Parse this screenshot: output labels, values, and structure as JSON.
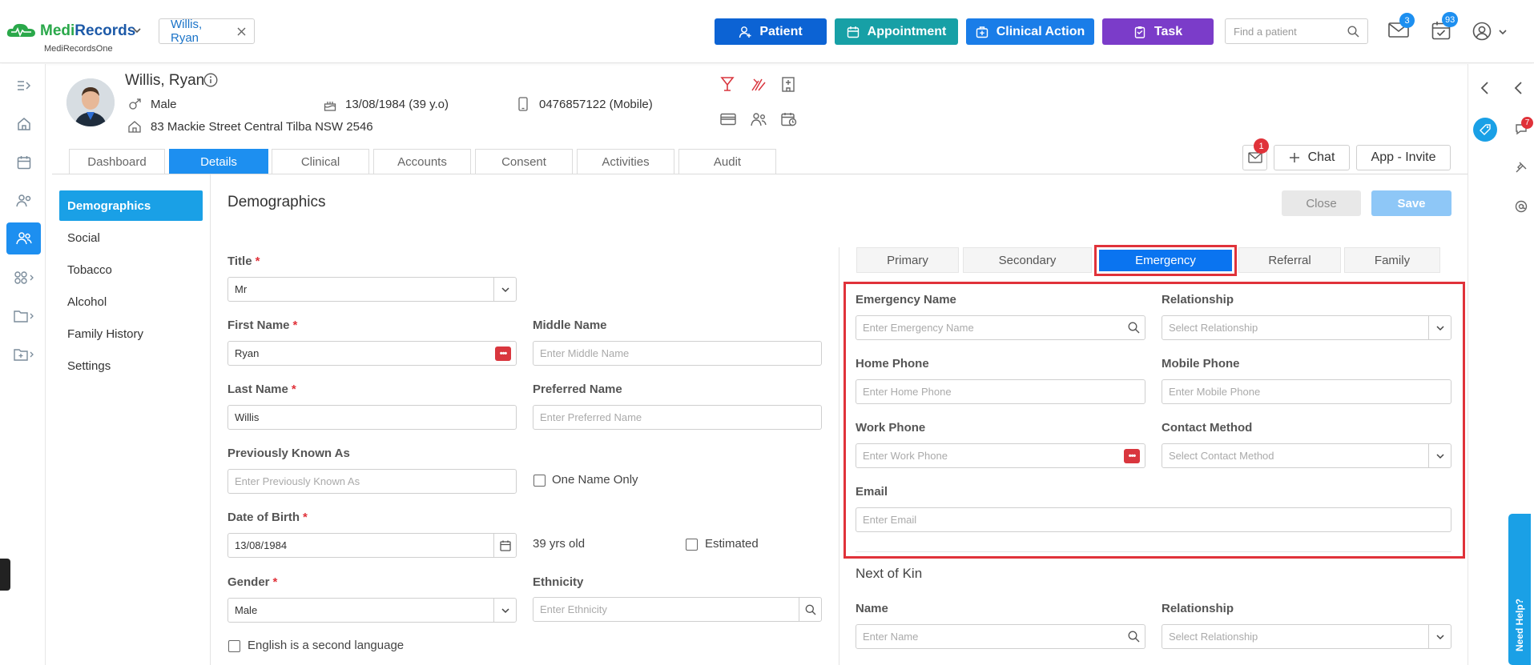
{
  "brand": {
    "name_part1": "Medi",
    "name_part2": "Records",
    "sub": "MediRecordsOne"
  },
  "header": {
    "patient_chip": "Willis, Ryan",
    "quick_buttons": [
      {
        "label": "Patient",
        "color": "#0c63d4"
      },
      {
        "label": "Appointment",
        "color": "#17a0a6"
      },
      {
        "label": "Clinical Action",
        "color": "#1a7de8"
      },
      {
        "label": "Task",
        "color": "#7b3cc9"
      }
    ],
    "find_placeholder": "Find a patient",
    "mail_badge": "3",
    "tasks_badge": "93"
  },
  "patient": {
    "name": "Willis, Ryan",
    "gender": "Male",
    "dob": "13/08/1984 (39 y.o)",
    "phone": "0476857122 (Mobile)",
    "address": "83 Mackie Street Central Tilba NSW 2546"
  },
  "tabs": [
    "Dashboard",
    "Details",
    "Clinical",
    "Accounts",
    "Consent",
    "Activities",
    "Audit"
  ],
  "active_tab": "Details",
  "header_actions": {
    "message_badge": "1",
    "chat_label": "Chat",
    "app_invite_label": "App - Invite"
  },
  "subnav": [
    "Demographics",
    "Social",
    "Tobacco",
    "Alcohol",
    "Family History",
    "Settings"
  ],
  "section": {
    "title": "Demographics",
    "close_label": "Close",
    "save_label": "Save"
  },
  "form": {
    "title_label": "Title",
    "title_value": "Mr",
    "first_name_label": "First Name",
    "first_name_value": "Ryan",
    "middle_name_label": "Middle Name",
    "middle_name_placeholder": "Enter Middle Name",
    "last_name_label": "Last Name",
    "last_name_value": "Willis",
    "preferred_name_label": "Preferred Name",
    "preferred_name_placeholder": "Enter Preferred Name",
    "prev_known_label": "Previously Known As",
    "prev_known_placeholder": "Enter Previously Known As",
    "one_name_only_label": "One Name Only",
    "dob_label": "Date of Birth",
    "dob_value": "13/08/1984",
    "age_text": "39 yrs old",
    "estimated_label": "Estimated",
    "gender_label": "Gender",
    "gender_value": "Male",
    "ethnicity_label": "Ethnicity",
    "ethnicity_placeholder": "Enter Ethnicity",
    "esl_label": "English is a second language"
  },
  "contact_tabs": [
    "Primary",
    "Secondary",
    "Emergency",
    "Referral",
    "Family"
  ],
  "active_contact_tab": "Emergency",
  "emergency": {
    "name_label": "Emergency Name",
    "name_placeholder": "Enter Emergency Name",
    "relationship_label": "Relationship",
    "relationship_placeholder": "Select Relationship",
    "home_phone_label": "Home Phone",
    "home_phone_placeholder": "Enter Home Phone",
    "mobile_phone_label": "Mobile Phone",
    "mobile_phone_placeholder": "Enter Mobile Phone",
    "work_phone_label": "Work Phone",
    "work_phone_placeholder": "Enter Work Phone",
    "contact_method_label": "Contact Method",
    "contact_method_placeholder": "Select Contact Method",
    "email_label": "Email",
    "email_placeholder": "Enter Email"
  },
  "next_of_kin": {
    "title": "Next of Kin",
    "name_label": "Name",
    "name_placeholder": "Enter Name",
    "relationship_label": "Relationship",
    "relationship_placeholder": "Select Relationship"
  },
  "right_rail": {
    "chat_badge": "7",
    "need_help_label": "Need Help?"
  },
  "colors": {
    "accent": "#1d8ff0",
    "highlight": "#e0323a",
    "required": "#e0323a"
  }
}
